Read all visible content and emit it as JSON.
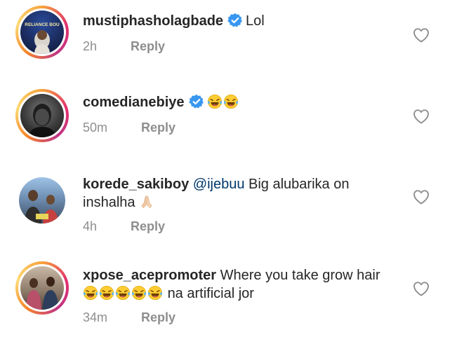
{
  "comments": [
    {
      "username": "mustiphasholagbade",
      "verified": true,
      "text_before": "",
      "mention": "",
      "text": "Lol",
      "time": "2h",
      "reply_label": "Reply",
      "avatar_caption": "RELIANCE BOU"
    },
    {
      "username": "comedianebiye",
      "verified": true,
      "text_before": "",
      "mention": "",
      "text": "",
      "emojis": [
        "face-with-tears-of-joy",
        "face-with-tears-of-joy"
      ],
      "time": "50m",
      "reply_label": "Reply"
    },
    {
      "username": "korede_sakiboy",
      "verified": false,
      "mention": "@ijebuu",
      "text": "Big alubarika on inshalha",
      "emojis": [
        "folded-hands"
      ],
      "time": "4h",
      "reply_label": "Reply"
    },
    {
      "username": "xpose_acepromoter",
      "verified": false,
      "mention": "",
      "text": "Where you take grow hair",
      "emojis": [
        "face-with-tears-of-joy",
        "face-with-tears-of-joy",
        "face-with-tears-of-joy",
        "face-with-tears-of-joy",
        "face-with-tears-of-joy"
      ],
      "text_after": "na artificial jor",
      "time": "34m",
      "reply_label": "Reply"
    }
  ],
  "colors": {
    "text": "#262626",
    "meta": "#8e8e8e",
    "mention": "#00376b",
    "verified_badge": "#3897f0"
  }
}
